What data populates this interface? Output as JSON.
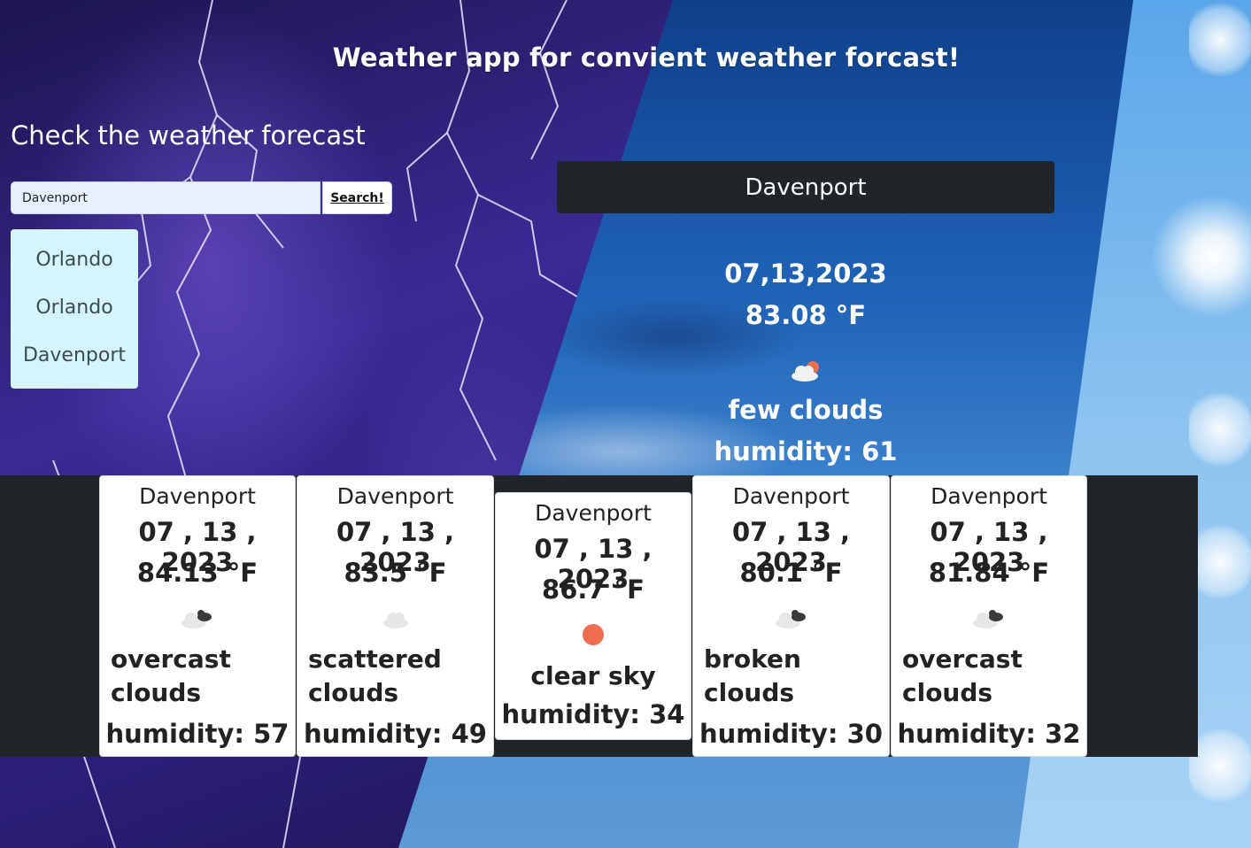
{
  "header": {
    "title": "Weather app for convient weather forcast!",
    "section_title": "Check the weather forecast"
  },
  "search": {
    "value": "Davenport",
    "button_label": "Search!"
  },
  "history": [
    "Orlando",
    "Orlando",
    "Davenport"
  ],
  "current": {
    "city": "Davenport",
    "date": "07,13,2023",
    "temp": "83.08 °F",
    "icon": "few-clouds-icon",
    "description": "few clouds",
    "humidity": "humidity: 61"
  },
  "forecast": [
    {
      "city": "Davenport",
      "date": "07 , 13 , 2023",
      "temp": "84.13 °F",
      "icon": "overcast-clouds-icon",
      "description": "overcast clouds",
      "humidity": "humidity: 57"
    },
    {
      "city": "Davenport",
      "date": "07 , 13 , 2023",
      "temp": "83.5 °F",
      "icon": "scattered-clouds-icon",
      "description": "scattered clouds",
      "humidity": "humidity: 49"
    },
    {
      "city": "Davenport",
      "date": "07 , 13 , 2023",
      "temp": "86.7 °F",
      "icon": "clear-sky-icon",
      "description": "clear sky",
      "humidity": "humidity: 34"
    },
    {
      "city": "Davenport",
      "date": "07 , 13 , 2023",
      "temp": "80.1 °F",
      "icon": "broken-clouds-icon",
      "description": "broken clouds",
      "humidity": "humidity: 30"
    },
    {
      "city": "Davenport",
      "date": "07 , 13 , 2023",
      "temp": "81.84 °F",
      "icon": "overcast-clouds-icon",
      "description": "overcast clouds",
      "humidity": "humidity: 32"
    }
  ],
  "colors": {
    "banner": "#212529",
    "history_bg": "#d4f5fb",
    "sun_icon": "#ee6e4f"
  }
}
